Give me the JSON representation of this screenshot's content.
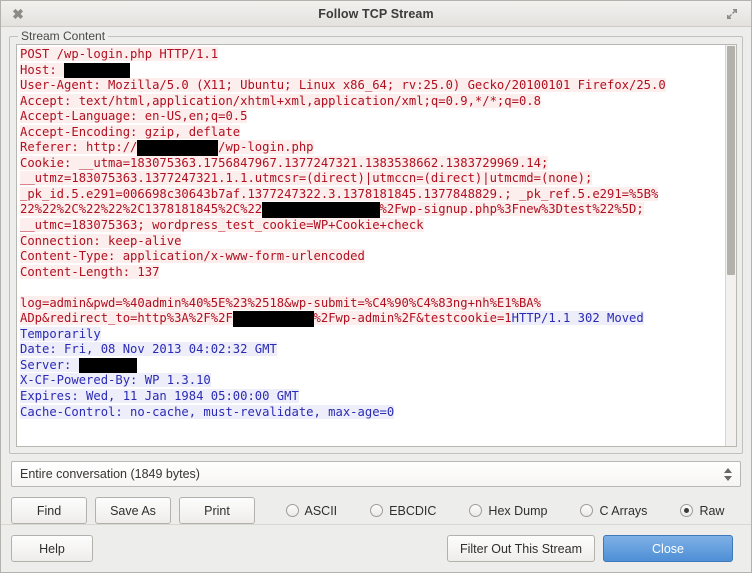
{
  "window": {
    "title": "Follow TCP Stream",
    "close_icon": "close-icon",
    "maximize_icon": "maximize-icon"
  },
  "groupbox": {
    "label": "Stream Content"
  },
  "stream": {
    "lines": [
      {
        "dir": "req",
        "segments": [
          {
            "t": "POST /wp-login.php HTTP/1.1"
          }
        ]
      },
      {
        "dir": "req",
        "segments": [
          {
            "t": "Host: "
          },
          {
            "redact": 9
          }
        ]
      },
      {
        "dir": "req",
        "segments": [
          {
            "t": "User-Agent: Mozilla/5.0 (X11; Ubuntu; Linux x86_64; rv:25.0) Gecko/20100101 Firefox/25.0"
          }
        ]
      },
      {
        "dir": "req",
        "segments": [
          {
            "t": "Accept: text/html,application/xhtml+xml,application/xml;q=0.9,*/*;q=0.8"
          }
        ]
      },
      {
        "dir": "req",
        "segments": [
          {
            "t": "Accept-Language: en-US,en;q=0.5"
          }
        ]
      },
      {
        "dir": "req",
        "segments": [
          {
            "t": "Accept-Encoding: gzip, deflate"
          }
        ]
      },
      {
        "dir": "req",
        "segments": [
          {
            "t": "Referer: http://"
          },
          {
            "redact": 11
          },
          {
            "t": "/wp-login.php"
          }
        ]
      },
      {
        "dir": "req",
        "segments": [
          {
            "t": "Cookie: __utma=183075363.1756847967.1377247321.1383538662.1383729969.14;"
          }
        ]
      },
      {
        "dir": "req",
        "segments": [
          {
            "t": "__utmz=183075363.1377247321.1.1.utmcsr=(direct)|utmccn=(direct)|utmcmd=(none);"
          }
        ]
      },
      {
        "dir": "req",
        "segments": [
          {
            "t": "_pk_id.5.e291=006698c30643b7af.1377247322.3.1378181845.1377848829.; _pk_ref.5.e291=%5B%"
          }
        ]
      },
      {
        "dir": "req",
        "segments": [
          {
            "t": "22%22%2C%22%22%2C1378181845%2C%22"
          },
          {
            "redact": 16
          },
          {
            "t": "%2Fwp-signup.php%3Fnew%3Dtest%22%5D;"
          }
        ]
      },
      {
        "dir": "req",
        "segments": [
          {
            "t": "__utmc=183075363; wordpress_test_cookie=WP+Cookie+check"
          }
        ]
      },
      {
        "dir": "req",
        "segments": [
          {
            "t": "Connection: keep-alive"
          }
        ]
      },
      {
        "dir": "req",
        "segments": [
          {
            "t": "Content-Type: application/x-www-form-urlencoded"
          }
        ]
      },
      {
        "dir": "req",
        "segments": [
          {
            "t": "Content-Length: 137"
          }
        ]
      },
      {
        "dir": "req",
        "segments": [
          {
            "t": ""
          }
        ]
      },
      {
        "dir": "req",
        "segments": [
          {
            "t": "log=admin&pwd=%40admin%40%5E%23%2518&wp-submit=%C4%90%C4%83ng+nh%E1%BA%"
          }
        ]
      },
      {
        "dir": "mixed",
        "segments": [
          {
            "t": "ADp&redirect_to=http%3A%2F%2F",
            "cls": "req"
          },
          {
            "redact": 11,
            "cls": "req"
          },
          {
            "t": "%2Fwp-admin%2F&testcookie=1",
            "cls": "req"
          },
          {
            "t": "HTTP/1.1 302 Moved",
            "cls": "res"
          }
        ]
      },
      {
        "dir": "res",
        "segments": [
          {
            "t": "Temporarily"
          }
        ]
      },
      {
        "dir": "res",
        "segments": [
          {
            "t": "Date: Fri, 08 Nov 2013 04:02:32 GMT"
          }
        ]
      },
      {
        "dir": "res",
        "segments": [
          {
            "t": "Server: "
          },
          {
            "redact": 8
          }
        ]
      },
      {
        "dir": "res",
        "segments": [
          {
            "t": "X-CF-Powered-By: WP 1.3.10"
          }
        ]
      },
      {
        "dir": "res",
        "segments": [
          {
            "t": "Expires: Wed, 11 Jan 1984 05:00:00 GMT"
          }
        ]
      },
      {
        "dir": "res",
        "segments": [
          {
            "t": "Cache-Control: no-cache, must-revalidate, max-age=0"
          }
        ]
      }
    ]
  },
  "combo": {
    "value": "Entire conversation (1849 bytes)"
  },
  "controls": {
    "find_label": "Find",
    "save_as_label": "Save As",
    "print_label": "Print",
    "formats": [
      {
        "label": "ASCII",
        "checked": false
      },
      {
        "label": "EBCDIC",
        "checked": false
      },
      {
        "label": "Hex Dump",
        "checked": false
      },
      {
        "label": "C Arrays",
        "checked": false
      },
      {
        "label": "Raw",
        "checked": true
      }
    ]
  },
  "footer": {
    "help_label": "Help",
    "filter_out_label": "Filter Out This Stream",
    "close_label": "Close"
  },
  "colors": {
    "request_text": "#b01020",
    "request_bg": "#fdeeee",
    "response_text": "#2a2ab4",
    "response_bg": "#eeeefb",
    "primary_button": "#4e8fd6"
  }
}
